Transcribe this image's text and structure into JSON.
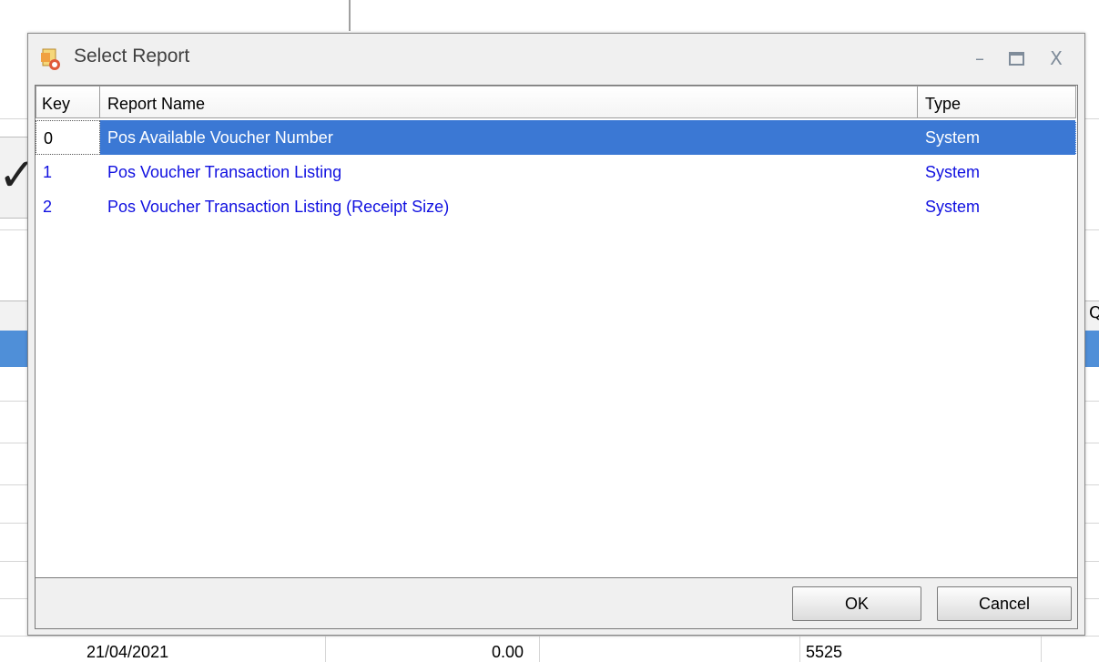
{
  "dialog": {
    "title": "Select Report",
    "controls": {
      "minimize": "–",
      "close": "X"
    }
  },
  "report_list": {
    "columns": {
      "key": "Key",
      "name": "Report Name",
      "type": "Type"
    },
    "rows": [
      {
        "key": "0",
        "name": "Pos Available Voucher Number",
        "type": "System",
        "selected": true
      },
      {
        "key": "1",
        "name": "Pos Voucher Transaction Listing",
        "type": "System",
        "selected": false
      },
      {
        "key": "2",
        "name": "Pos Voucher Transaction Listing (Receipt Size)",
        "type": "System",
        "selected": false
      }
    ]
  },
  "buttons": {
    "ok": "OK",
    "cancel": "Cancel"
  },
  "background": {
    "header_fragment": "Q",
    "row": {
      "date": "21/04/2021",
      "amount": "0.00",
      "number": "5525"
    }
  },
  "colors": {
    "selection": "#3b78d4",
    "row_text": "#1010e0",
    "background_selection": "#4f8fd8"
  }
}
